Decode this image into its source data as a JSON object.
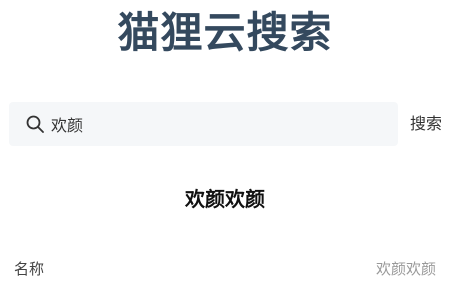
{
  "app": {
    "title": "猫狸云搜索",
    "title_color": "#34495e"
  },
  "search": {
    "value": "欢颜",
    "button_label": "搜索",
    "icon": "search-icon",
    "box_color": "#f5f7f9"
  },
  "result": {
    "title": "欢颜欢颜",
    "fields": [
      {
        "label": "名称",
        "value": "欢颜欢颜"
      }
    ]
  }
}
